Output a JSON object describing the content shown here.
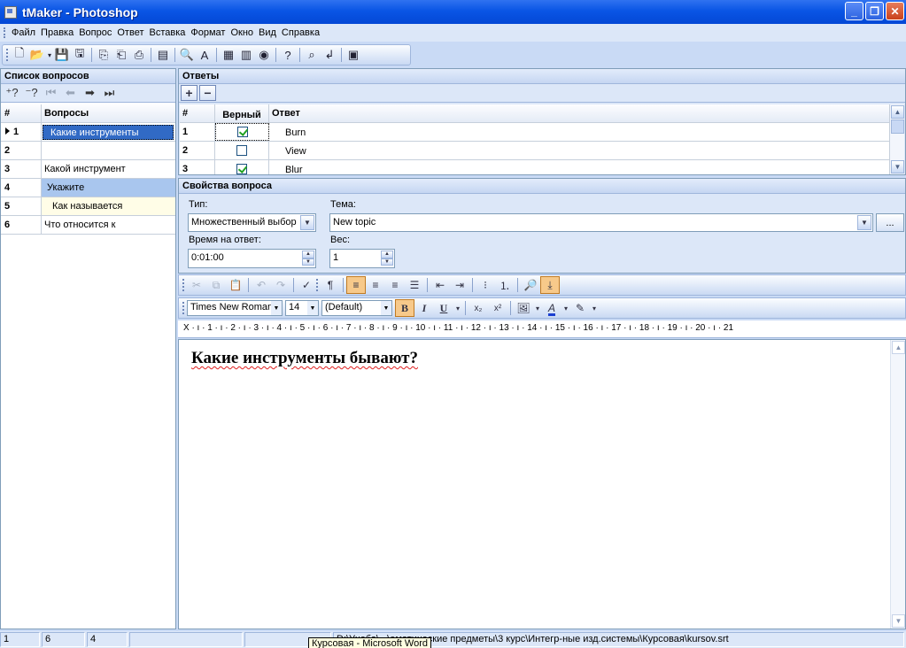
{
  "window": {
    "title": "tMaker - Photoshop"
  },
  "menu": [
    "Файл",
    "Правка",
    "Вопрос",
    "Ответ",
    "Вставка",
    "Формат",
    "Окно",
    "Вид",
    "Справка"
  ],
  "questions_panel": {
    "title": "Список вопросов",
    "columns": {
      "num": "#",
      "text": "Вопросы"
    },
    "rows": [
      {
        "num": "1",
        "text": "Какие инструменты"
      },
      {
        "num": "2",
        "text": ""
      },
      {
        "num": "3",
        "text": "Какой инструмент"
      },
      {
        "num": "4",
        "text": "Укажите"
      },
      {
        "num": "5",
        "text": "Как называется"
      },
      {
        "num": "6",
        "text": "Что относится к"
      }
    ]
  },
  "answers_panel": {
    "title": "Ответы",
    "columns": {
      "num": "#",
      "correct": "Верный",
      "answer": "Ответ"
    },
    "rows": [
      {
        "num": "1",
        "correct": true,
        "answer": "Burn"
      },
      {
        "num": "2",
        "correct": false,
        "answer": "View"
      },
      {
        "num": "3",
        "correct": true,
        "answer": "Blur"
      }
    ]
  },
  "properties": {
    "title": "Свойства вопроса",
    "type_label": "Тип:",
    "type_value": "Множественный выбор",
    "topic_label": "Тема:",
    "topic_value": "New topic",
    "more_button": "...",
    "time_label": "Время на ответ:",
    "time_value": "0:01:00",
    "weight_label": "Вес:",
    "weight_value": "1"
  },
  "format_toolbar": {
    "font": "Times New Roman",
    "size": "14",
    "style": "(Default)",
    "bold": "B",
    "italic": "I",
    "underline": "U"
  },
  "ruler": "X · ı · 1 · ı · 2 · ı · 3 · ı · 4 · ı · 5 · ı · 6 · ı · 7 · ı · 8 · ı · 9 · ı · 10 · ı · 11 · ı · 12 · ı · 13 · ı · 14 · ı · 15 · ı · 16 · ı · 17 · ı · 18 · ı · 19 · ı · 20 · ı · 21",
  "editor": {
    "text": "Какие инструменты бывают?"
  },
  "status": {
    "current": "1",
    "total": "6",
    "answers": "4",
    "path": "D:\\Учеба\\...\\ематические предметы\\3 курс\\Интегр-ные изд.системы\\Курсовая\\kursov.srt"
  },
  "tooltip": "Курсовая - Microsoft Word"
}
